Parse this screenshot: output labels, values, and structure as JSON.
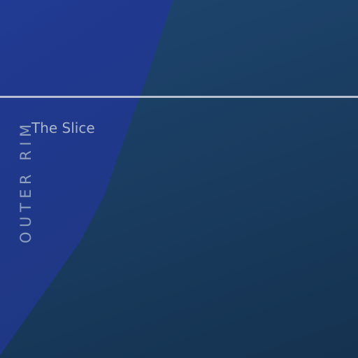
{
  "cover": {
    "vertical_title": "OUTER RIM",
    "subtitle": "The Slice"
  },
  "colors": {
    "background": "#1a3d61",
    "slice": "#21388c",
    "divider": "#c9ced8",
    "title_text": "#8ea0bd",
    "subtitle_text": "#aab7cc"
  }
}
